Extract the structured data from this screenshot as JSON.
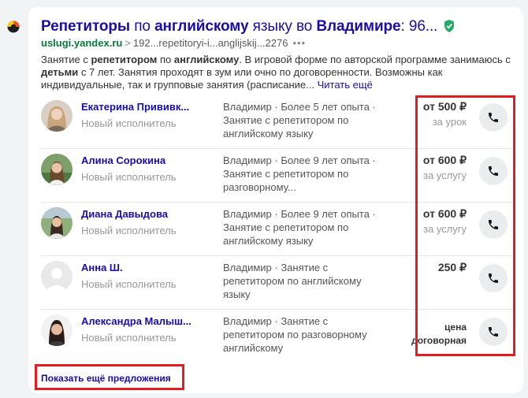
{
  "result": {
    "title_parts": [
      "Репетиторы",
      " по ",
      "английскому",
      " языку во ",
      "Владимире",
      ": 96..."
    ],
    "domain": "uslugi.yandex.ru",
    "separator": ">",
    "path": "192...repetitoryi-i...anglijskij...2276",
    "dots": "•••",
    "snippet_parts": [
      "Занятие с ",
      "репетитором",
      " по ",
      "английскому",
      ". В игровой форме по авторской программе занимаюсь с ",
      "детьми",
      " с 7 лет. Занятия проходят в зум или очно по договоренности. Возможны как индивидуальные, так и групповые занятия (расписание... "
    ],
    "read_more": "Читать ещё",
    "verified_icon_color": "#26a96c"
  },
  "tutors": [
    {
      "name": "Екатерина Прививк...",
      "status": "Новый исполнитель",
      "desc": "Владимир · Более 5 лет опыта · Занятие с репетитором по английскому языку",
      "price": "от 500 ₽",
      "unit": "за урок",
      "avatar": "woman-light"
    },
    {
      "name": "Алина Сорокина",
      "status": "Новый исполнитель",
      "desc": "Владимир · Более 9 лет опыта · Занятие с репетитором по разговорному...",
      "price": "от 600 ₽",
      "unit": "за услугу",
      "avatar": "woman-green"
    },
    {
      "name": "Диана Давыдова",
      "status": "Новый исполнитель",
      "desc": "Владимир · Более 9 лет опыта · Занятие с репетитором по английскому языку",
      "price": "от 600 ₽",
      "unit": "за услугу",
      "avatar": "woman-outdoor"
    },
    {
      "name": "Анна Ш.",
      "status": "Новый исполнитель",
      "desc": "Владимир · Занятие с репетитором по английскому языку",
      "price": "250 ₽",
      "unit": "",
      "avatar": "placeholder"
    },
    {
      "name": "Александра Малыш...",
      "status": "Новый исполнитель",
      "desc": "Владимир · Занятие с репетитором по разговорному английскому",
      "price_lines": [
        "цена",
        "договорная"
      ],
      "avatar": "woman-dark"
    }
  ],
  "call_icon": "phone-icon",
  "show_more": "Показать ещё предложения",
  "colors": {
    "link": "#1a0dab",
    "domain": "#0a7a3a",
    "highlight": "#e31b23"
  }
}
